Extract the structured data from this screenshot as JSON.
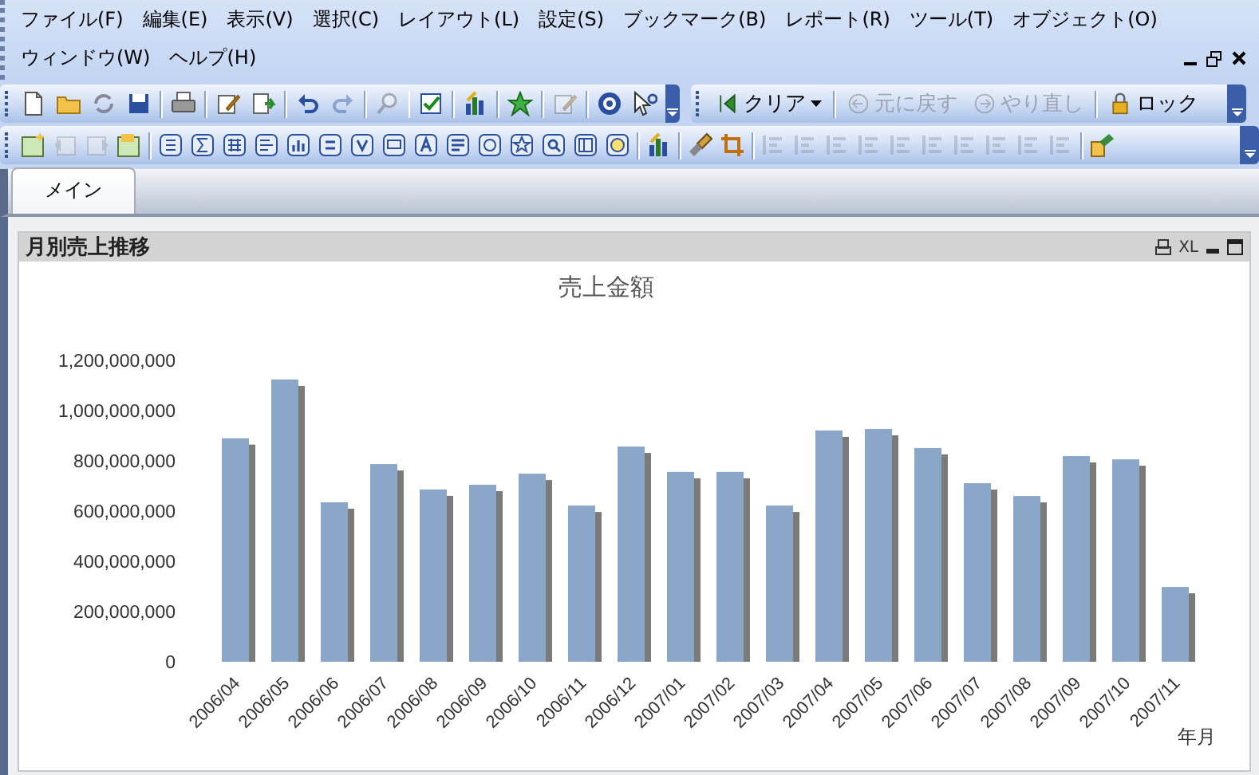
{
  "menu": [
    {
      "label": "ファイル(F)"
    },
    {
      "label": "編集(E)"
    },
    {
      "label": "表示(V)"
    },
    {
      "label": "選択(C)"
    },
    {
      "label": "レイアウト(L)"
    },
    {
      "label": "設定(S)"
    },
    {
      "label": "ブックマーク(B)"
    },
    {
      "label": "レポート(R)"
    },
    {
      "label": "ツール(T)"
    },
    {
      "label": "オブジェクト(O)"
    },
    {
      "label": "ウィンドウ(W)"
    },
    {
      "label": "ヘルプ(H)"
    }
  ],
  "toolbar_1": [
    {
      "kind": "button",
      "disabled": false
    },
    {
      "kind": "button",
      "disabled": false
    },
    {
      "kind": "button",
      "disabled": false
    },
    {
      "kind": "button",
      "disabled": false
    },
    {
      "kind": "separator"
    },
    {
      "kind": "button",
      "disabled": false
    },
    {
      "kind": "separator"
    },
    {
      "kind": "button",
      "disabled": false
    },
    {
      "kind": "button",
      "disabled": false
    },
    {
      "kind": "separator"
    },
    {
      "kind": "button",
      "disabled": false
    },
    {
      "kind": "button",
      "disabled": true
    },
    {
      "kind": "separator"
    },
    {
      "kind": "button",
      "disabled": true
    },
    {
      "kind": "separator"
    },
    {
      "kind": "button",
      "disabled": false
    },
    {
      "kind": "separator"
    },
    {
      "kind": "button",
      "disabled": false
    },
    {
      "kind": "separator"
    },
    {
      "kind": "button",
      "disabled": false
    },
    {
      "kind": "separator"
    },
    {
      "kind": "button",
      "disabled": true
    },
    {
      "kind": "separator"
    },
    {
      "kind": "button",
      "disabled": false
    },
    {
      "kind": "button",
      "disabled": false
    }
  ],
  "toolbar_2": [
    {
      "kind": "dropdown",
      "label": "クリア",
      "disabled": false
    },
    {
      "kind": "separator"
    },
    {
      "kind": "button",
      "label": "元に戻す",
      "disabled": true
    },
    {
      "kind": "button",
      "label": "やり直し",
      "disabled": true
    },
    {
      "kind": "separator"
    },
    {
      "kind": "button",
      "label": "ロック",
      "disabled": false
    }
  ],
  "toolbar_3": [
    {
      "kind": "button",
      "disabled": false
    },
    {
      "kind": "button",
      "disabled": true
    },
    {
      "kind": "button",
      "disabled": true
    },
    {
      "kind": "button",
      "disabled": false
    },
    {
      "kind": "separator"
    },
    {
      "kind": "button",
      "disabled": false
    },
    {
      "kind": "button",
      "disabled": false
    },
    {
      "kind": "button",
      "disabled": false
    },
    {
      "kind": "button",
      "disabled": false
    },
    {
      "kind": "button",
      "disabled": false
    },
    {
      "kind": "button",
      "disabled": false
    },
    {
      "kind": "button",
      "disabled": false
    },
    {
      "kind": "button",
      "disabled": false
    },
    {
      "kind": "button",
      "disabled": false
    },
    {
      "kind": "button",
      "disabled": false
    },
    {
      "kind": "button",
      "disabled": false
    },
    {
      "kind": "button",
      "disabled": false
    },
    {
      "kind": "button",
      "disabled": false
    },
    {
      "kind": "button",
      "disabled": false
    },
    {
      "kind": "button",
      "disabled": false
    },
    {
      "kind": "separator"
    },
    {
      "kind": "button",
      "disabled": false
    },
    {
      "kind": "separator"
    },
    {
      "kind": "button",
      "disabled": false
    },
    {
      "kind": "button",
      "disabled": false
    },
    {
      "kind": "separator"
    },
    {
      "kind": "button",
      "disabled": true
    },
    {
      "kind": "button",
      "disabled": true
    },
    {
      "kind": "button",
      "disabled": true
    },
    {
      "kind": "button",
      "disabled": true
    },
    {
      "kind": "button",
      "disabled": true
    },
    {
      "kind": "button",
      "disabled": true
    },
    {
      "kind": "button",
      "disabled": true
    },
    {
      "kind": "button",
      "disabled": true
    },
    {
      "kind": "button",
      "disabled": true
    },
    {
      "kind": "button",
      "disabled": true
    },
    {
      "kind": "separator"
    },
    {
      "kind": "button",
      "disabled": false
    }
  ],
  "tabs": [
    {
      "label": "メイン",
      "selected": true
    }
  ],
  "panel": {
    "title": "月別売上推移",
    "export_label": "XL",
    "chart_data": {
      "type": "bar",
      "title": "売上金額",
      "xlabel": "年月",
      "categories": [
        "2006/04",
        "2006/05",
        "2006/06",
        "2006/07",
        "2006/08",
        "2006/09",
        "2006/10",
        "2006/11",
        "2006/12",
        "2007/01",
        "2007/02",
        "2007/03",
        "2007/04",
        "2007/05",
        "2007/06",
        "2007/07",
        "2007/08",
        "2007/09",
        "2007/10",
        "2007/11"
      ],
      "series": [
        {
          "color": "#8aa6c8",
          "values": [
            890000000,
            1124000000,
            635000000,
            787000000,
            686000000,
            705000000,
            749000000,
            622000000,
            857000000,
            756000000,
            756000000,
            622000000,
            921000000,
            927000000,
            851000000,
            711000000,
            660000000,
            819000000,
            806000000,
            298000000
          ]
        }
      ],
      "ylim": [
        0,
        1200000000
      ],
      "yticks": [
        {
          "value": 0,
          "label": "0"
        },
        {
          "value": 200000000,
          "label": "200,000,000"
        },
        {
          "value": 400000000,
          "label": "400,000,000"
        },
        {
          "value": 600000000,
          "label": "600,000,000"
        },
        {
          "value": 800000000,
          "label": "800,000,000"
        },
        {
          "value": 1000000000,
          "label": "1,000,000,000"
        },
        {
          "value": 1200000000,
          "label": "1,200,000,000"
        }
      ]
    }
  }
}
